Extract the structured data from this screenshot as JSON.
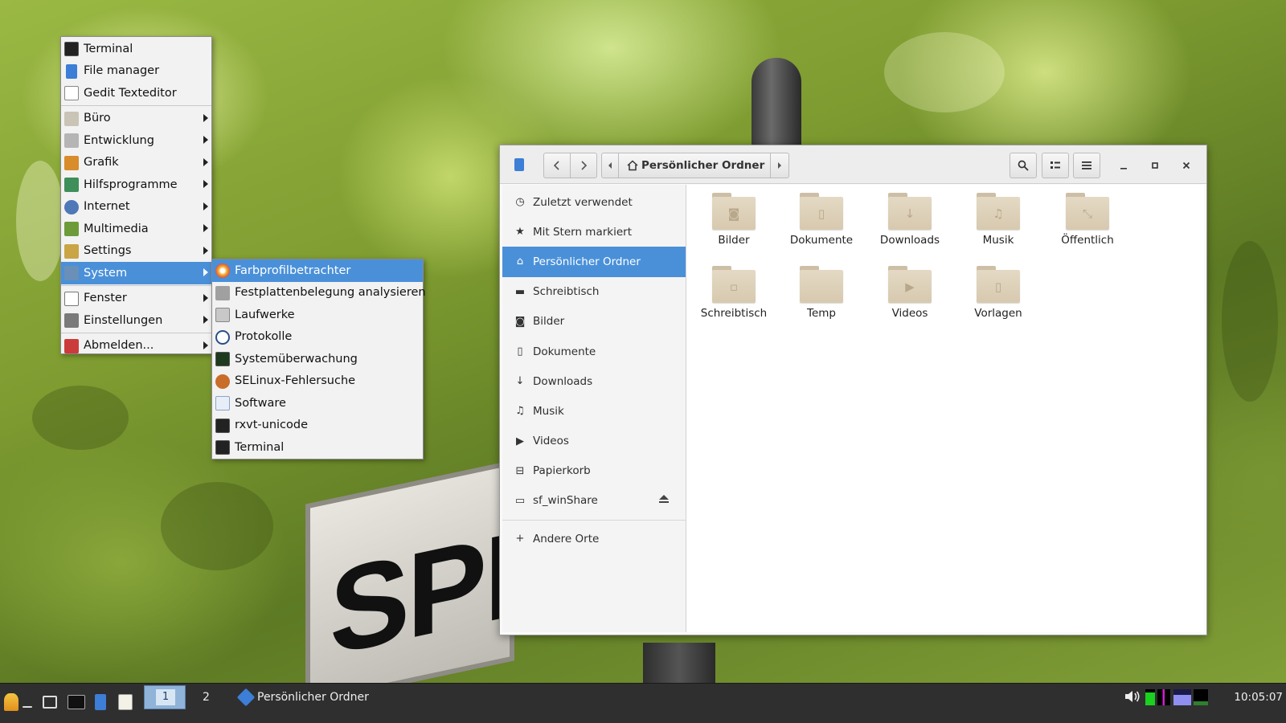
{
  "wallpaper": {
    "sign_text": "SPR"
  },
  "app_menu": {
    "items": [
      {
        "label": "Terminal",
        "icon": "terminal-icon"
      },
      {
        "label": "File manager",
        "icon": "file-manager-icon"
      },
      {
        "label": "Gedit Texteditor",
        "icon": "text-editor-icon"
      },
      {
        "label": "Büro",
        "icon": "office-icon",
        "submenu": true
      },
      {
        "label": "Entwicklung",
        "icon": "development-icon",
        "submenu": true
      },
      {
        "label": "Grafik",
        "icon": "graphics-icon",
        "submenu": true
      },
      {
        "label": "Hilfsprogramme",
        "icon": "utilities-icon",
        "submenu": true
      },
      {
        "label": "Internet",
        "icon": "internet-icon",
        "submenu": true
      },
      {
        "label": "Multimedia",
        "icon": "multimedia-icon",
        "submenu": true
      },
      {
        "label": "Settings",
        "icon": "settings-icon",
        "submenu": true
      },
      {
        "label": "System",
        "icon": "system-icon",
        "submenu": true,
        "active": true
      },
      {
        "label": "Fenster",
        "icon": "window-icon",
        "submenu": true
      },
      {
        "label": "Einstellungen",
        "icon": "preferences-icon",
        "submenu": true
      },
      {
        "label": "Abmelden...",
        "icon": "logout-icon",
        "submenu": true
      }
    ]
  },
  "system_submenu": {
    "items": [
      {
        "label": "Farbprofilbetrachter",
        "active": true
      },
      {
        "label": "Festplattenbelegung analysieren"
      },
      {
        "label": "Laufwerke"
      },
      {
        "label": "Protokolle"
      },
      {
        "label": "Systemüberwachung"
      },
      {
        "label": "SELinux-Fehlersuche"
      },
      {
        "label": "Software"
      },
      {
        "label": "rxvt-unicode"
      },
      {
        "label": "Terminal"
      }
    ]
  },
  "file_manager": {
    "path_label": "Persönlicher Ordner",
    "sidebar": [
      {
        "label": "Zuletzt verwendet",
        "icon": "clock-icon"
      },
      {
        "label": "Mit Stern markiert",
        "icon": "star-icon"
      },
      {
        "label": "Persönlicher Ordner",
        "icon": "home-icon",
        "active": true
      },
      {
        "label": "Schreibtisch",
        "icon": "desktop-icon"
      },
      {
        "label": "Bilder",
        "icon": "camera-icon"
      },
      {
        "label": "Dokumente",
        "icon": "document-icon"
      },
      {
        "label": "Downloads",
        "icon": "download-icon"
      },
      {
        "label": "Musik",
        "icon": "music-icon"
      },
      {
        "label": "Videos",
        "icon": "video-icon"
      },
      {
        "label": "Papierkorb",
        "icon": "trash-icon"
      },
      {
        "label": "sf_winShare",
        "icon": "drive-icon"
      }
    ],
    "other_locations": "Andere Orte",
    "folders": [
      {
        "label": "Bilder",
        "icon": "camera-icon"
      },
      {
        "label": "Dokumente",
        "icon": "document-icon"
      },
      {
        "label": "Downloads",
        "icon": "download-icon"
      },
      {
        "label": "Musik",
        "icon": "music-icon"
      },
      {
        "label": "Öffentlich",
        "icon": "share-icon"
      },
      {
        "label": "Schreibtisch",
        "icon": "desktop-icon"
      },
      {
        "label": "Temp",
        "icon": "folder-icon"
      },
      {
        "label": "Videos",
        "icon": "video-icon"
      },
      {
        "label": "Vorlagen",
        "icon": "template-icon"
      }
    ]
  },
  "taskbar": {
    "workspace_1": "1",
    "workspace_2": "2",
    "task_label": "Persönlicher Ordner",
    "clock": "10:05:07"
  },
  "colors": {
    "selection": "#4a90d9",
    "taskbar": "#2f2f2f",
    "folder": "#e4d9c4"
  }
}
